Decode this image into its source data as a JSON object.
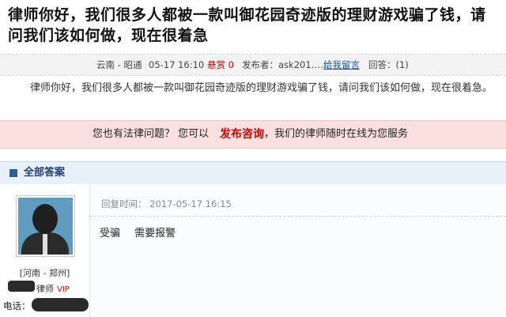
{
  "question": {
    "title": "律师你好，我们很多人都被一款叫御花园奇迹版的理财游戏骗了钱，请问我们该如何做，现在很着急",
    "meta": {
      "location": "云南 - 昭通",
      "datetime": "05-17 16:10",
      "bounty": "悬赏 0",
      "publisher": "发布者：ask201……",
      "leave_message_link": "给我留言",
      "reply_count": "回答：(1)"
    },
    "body": "律师你好，我们很多人都被一款叫御花园奇迹版的理财游戏骗了钱，请问我们该如何做，现在很着急。"
  },
  "cta": {
    "prefix": "您也有法律问题？ 您可以",
    "link": "发布咨询",
    "suffix": "，我们的律师随时在线为您服务"
  },
  "answers_section": {
    "title": "全部答案"
  },
  "answer": {
    "lawyer": {
      "location": "[河南 - 郑州]",
      "role": "律师",
      "badge": "VIP",
      "phone_label": "电话："
    },
    "reply_time": "回复时间： 2017-05-17 16:15",
    "reply_text": "受骗 需要报警"
  },
  "colors": {
    "accent_red": "#d40000",
    "link_blue": "#1a4f9c",
    "cta_bg": "#fbe0e0",
    "section_header_bg": "#e8f0f8"
  }
}
